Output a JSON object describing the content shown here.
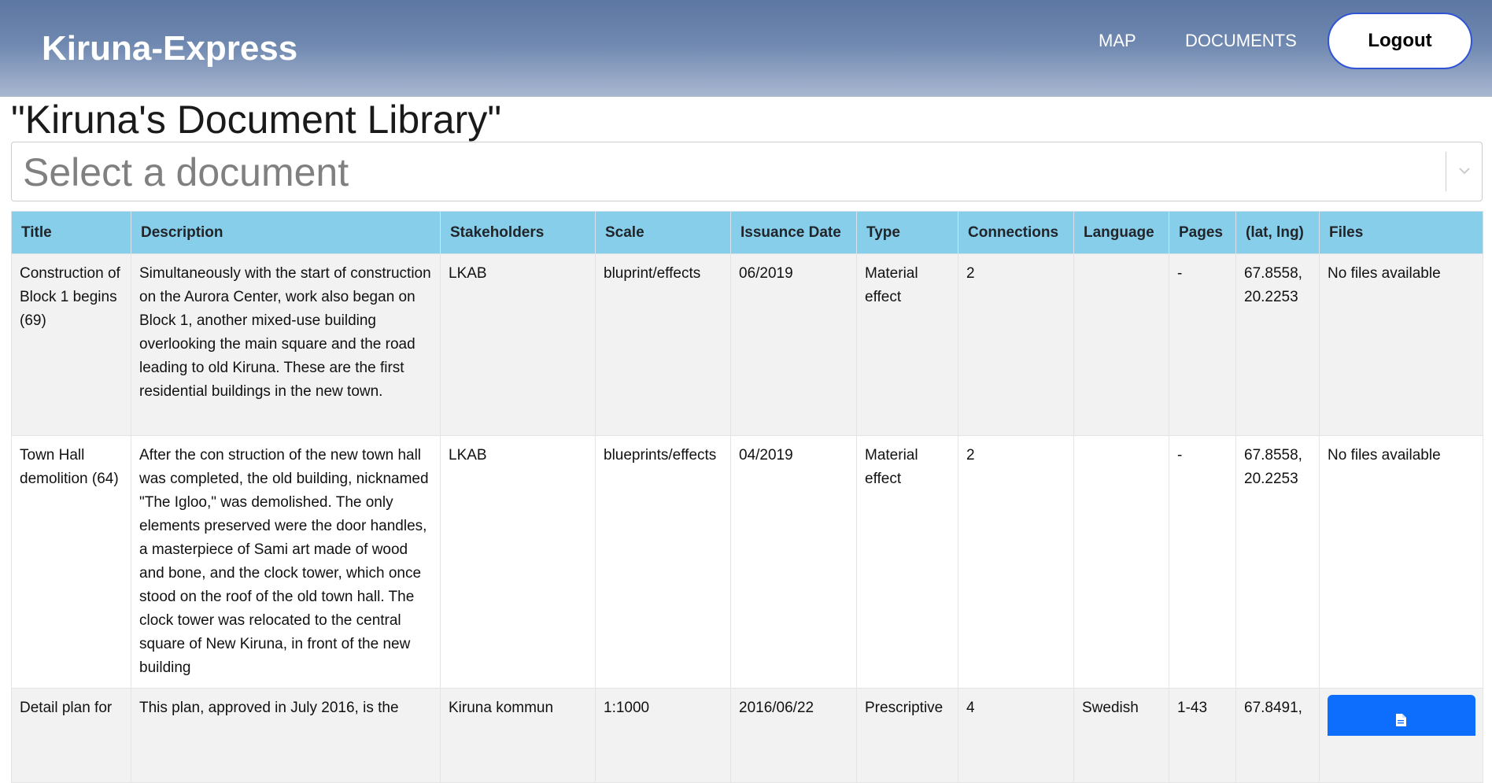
{
  "navbar": {
    "brand": "Kiruna-Express",
    "links": [
      "MAP",
      "DOCUMENTS"
    ],
    "logout_label": "Logout"
  },
  "page": {
    "title": "\"Kiruna's Document Library\""
  },
  "select": {
    "placeholder": "Select a document",
    "icon": "chevron-down-icon"
  },
  "table": {
    "headers": [
      "Title",
      "Description",
      "Stakeholders",
      "Scale",
      "Issuance Date",
      "Type",
      "Connections",
      "Language",
      "Pages",
      "(lat, lng)",
      "Files"
    ],
    "rows": [
      {
        "title": "Construction of Block 1 begins (69)",
        "description": "Simultaneously with the start of construction on the Aurora Center, work also began on Block 1, another mixed-use building overlooking the main square and the road leading to old Kiruna. These are the first residential buildings in the new town.",
        "stakeholders": "LKAB",
        "scale": "bluprint/effects",
        "date": "06/2019",
        "type": "Material effect",
        "connections": "2",
        "language": "",
        "pages": "-",
        "coords": "67.8558, 20.2253",
        "files": "No files available"
      },
      {
        "title": "Town Hall demolition (64)",
        "description": "After the con struction of the new town hall was completed, the old building, nicknamed \"The Igloo,\" was demolished. The only elements preserved were the door handles, a masterpiece of Sami art made of wood and bone, and the clock tower, which once stood on the roof of the old town hall. The clock tower was relocated to the central square of New Kiruna, in front of the new building",
        "stakeholders": "LKAB",
        "scale": "blueprints/effects",
        "date": "04/2019",
        "type": "Material effect",
        "connections": "2",
        "language": "",
        "pages": "-",
        "coords": "67.8558, 20.2253",
        "files": "No files available"
      },
      {
        "title": "Detail plan for",
        "description": "This plan, approved in July 2016, is the",
        "stakeholders": "Kiruna kommun",
        "scale": "1:1000",
        "date": "2016/06/22",
        "type": "Prescriptive",
        "connections": "4",
        "language": "Swedish",
        "pages": "1-43",
        "coords": "67.8491,",
        "files_icon": "file-icon"
      }
    ]
  }
}
